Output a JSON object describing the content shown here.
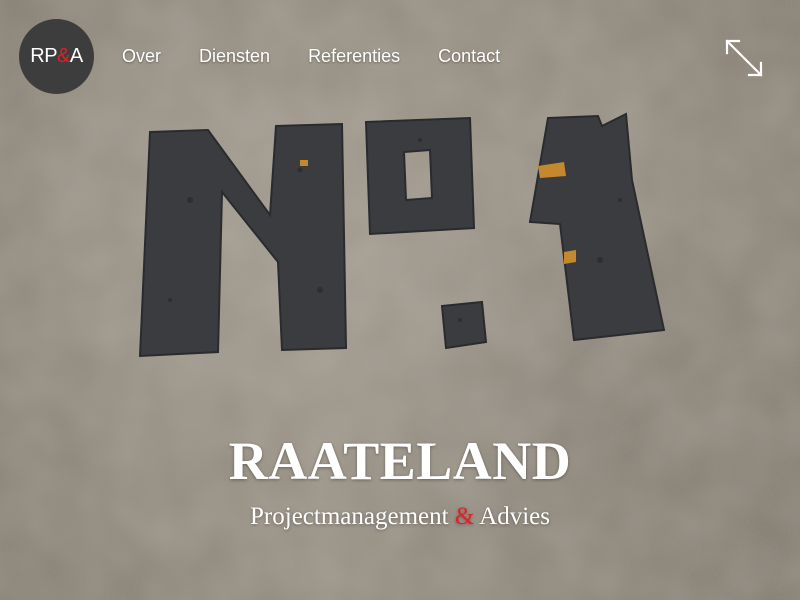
{
  "logo": {
    "left": "RP",
    "amp": "&",
    "right": "A"
  },
  "nav": {
    "items": [
      {
        "label": "Over"
      },
      {
        "label": "Diensten"
      },
      {
        "label": "Referenties"
      },
      {
        "label": "Contact"
      }
    ]
  },
  "hero": {
    "title": "RAATELAND",
    "subtitle_part1": "Projectmanagement",
    "subtitle_amp": "&",
    "subtitle_part2": "Advies",
    "image_subject": "stone plaque reading No.1"
  },
  "icons": {
    "fullscreen": "expand-arrows-icon"
  },
  "colors": {
    "accent": "#e02127",
    "logo_bg": "#3d3d3d",
    "text": "#ffffff"
  }
}
